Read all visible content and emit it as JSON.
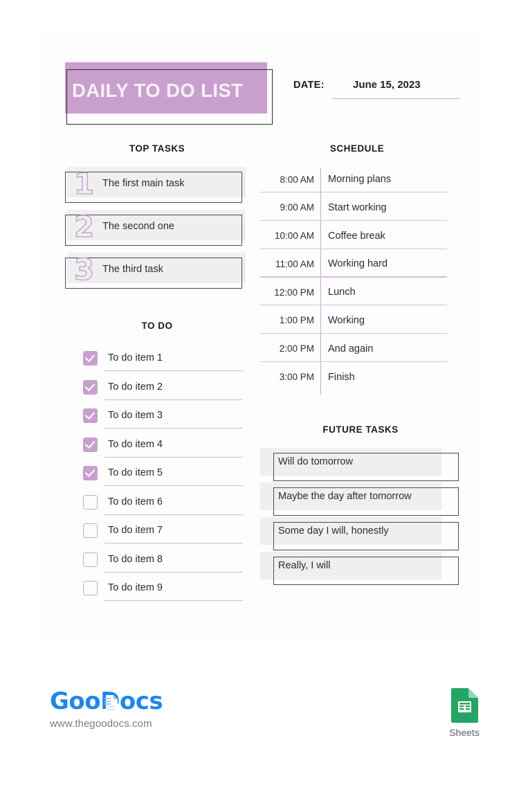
{
  "header": {
    "title": "DAILY TO DO LIST",
    "date_label": "DATE:",
    "date_value": "June 15, 2023"
  },
  "top_tasks": {
    "heading": "TOP TASKS",
    "items": [
      {
        "number": "1",
        "label": "The first main task"
      },
      {
        "number": "2",
        "label": "The second one"
      },
      {
        "number": "3",
        "label": "The third task"
      }
    ]
  },
  "todo": {
    "heading": "TO DO",
    "items": [
      {
        "label": "To do item 1",
        "checked": true
      },
      {
        "label": "To do item 2",
        "checked": true
      },
      {
        "label": "To do item 3",
        "checked": true
      },
      {
        "label": "To do item 4",
        "checked": true
      },
      {
        "label": "To do item 5",
        "checked": true
      },
      {
        "label": "To do item 6",
        "checked": false
      },
      {
        "label": "To do item 7",
        "checked": false
      },
      {
        "label": "To do item 8",
        "checked": false
      },
      {
        "label": "To do item 9",
        "checked": false
      }
    ]
  },
  "schedule": {
    "heading": "SCHEDULE",
    "rows": [
      {
        "time": "8:00 AM",
        "task": "Morning plans"
      },
      {
        "time": "9:00 AM",
        "task": "Start working"
      },
      {
        "time": "10:00 AM",
        "task": "Coffee break"
      },
      {
        "time": "11:00 AM",
        "task": "Working hard"
      },
      {
        "time": "12:00 PM",
        "task": "Lunch"
      },
      {
        "time": "1:00 PM",
        "task": "Working"
      },
      {
        "time": "2:00 PM",
        "task": "And again"
      },
      {
        "time": "3:00 PM",
        "task": "Finish"
      }
    ]
  },
  "future_tasks": {
    "heading": "FUTURE TASKS",
    "items": [
      {
        "label": "Will do tomorrow"
      },
      {
        "label": "Maybe the day after tomorrow"
      },
      {
        "label": "Some day I will, honestly"
      },
      {
        "label": "Really, I will"
      }
    ]
  },
  "footer": {
    "brand_part1": "Goo",
    "brand_part2": "Docs",
    "url": "www.thegoodocs.com",
    "sheets_caption": "Sheets"
  },
  "colors": {
    "accent_purple": "#c9a0cd",
    "rule_purple": "#cba6cf",
    "band_gray": "#efeff0",
    "frame_dark": "#4a4a52",
    "brand_blue": "#2086e8",
    "sheets_green": "#23a566"
  }
}
